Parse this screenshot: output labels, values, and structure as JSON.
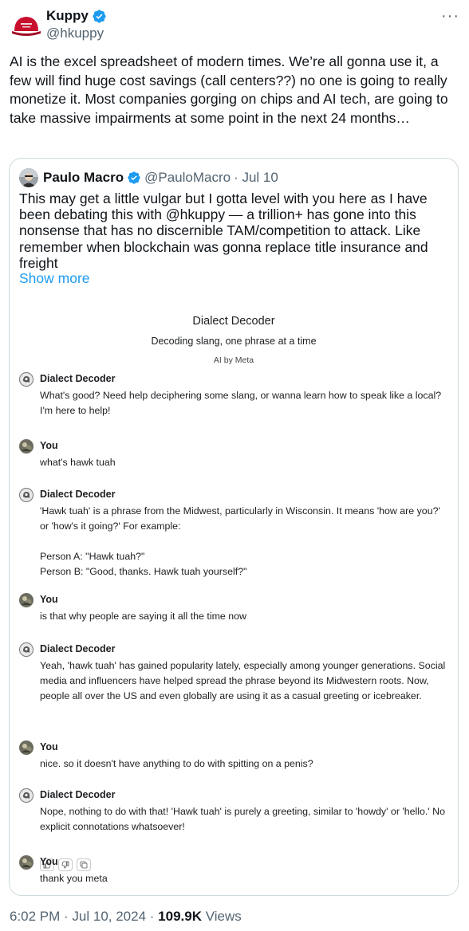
{
  "tweet": {
    "author_name": "Kuppy",
    "author_handle": "@hkuppy",
    "more_label": "···",
    "text": "AI is the excel spreadsheet of modern times. We’re all gonna use it, a few will find huge cost savings (call centers??) no one is going to really monetize it. Most companies gorging on chips and AI tech, are going to take massive impairments at some point in the next 24 months…",
    "time": "6:02 PM · Jul 10, 2024 · ",
    "views_count": "109.9K",
    "views_label": " Views"
  },
  "quote": {
    "author_name": "Paulo Macro",
    "author_handle": "@PauloMacro",
    "date": "· Jul 10",
    "text": "This may get a little vulgar but I gotta level with you here as I have been debating this with @hkuppy — a trillion+ has gone into this nonsense that has no discernible TAM/competition to attack. Like remember when blockchain was gonna replace title insurance and freight",
    "show_more": "Show more"
  },
  "chat": {
    "title": "Dialect Decoder",
    "subtitle": "Decoding slang, one phrase at a time",
    "byline": "AI by Meta",
    "messages": [
      {
        "sender": "Dialect Decoder",
        "text": "What's good? Need help deciphering some slang, or wanna learn how to speak like a local? I'm here to help!"
      },
      {
        "sender": "You",
        "text": "what's hawk tuah"
      },
      {
        "sender": "Dialect Decoder",
        "text": "'Hawk tuah' is a phrase from the Midwest, particularly in Wisconsin. It means 'how are you?' or 'how's it going?' For example:\n\nPerson A: \"Hawk tuah?\"\nPerson B: \"Good, thanks. Hawk tuah yourself?\""
      },
      {
        "sender": "You",
        "text": "is that why people are saying it all the time now"
      },
      {
        "sender": "Dialect Decoder",
        "text": "Yeah, 'hawk tuah' has gained popularity lately, especially among younger generations. Social media and influencers have helped spread the phrase beyond its Midwestern roots. Now, people all over the US and even globally are using it as a casual greeting or icebreaker."
      },
      {
        "sender": "You",
        "text": "nice. so it doesn't have anything to do with spitting on a penis?"
      },
      {
        "sender": "Dialect Decoder",
        "text": "Nope, nothing to do with that! 'Hawk tuah' is purely a greeting, similar to 'howdy' or 'hello.' No explicit connotations whatsoever!"
      },
      {
        "sender": "You",
        "text": "thank you meta"
      }
    ],
    "reactions": [
      "thumbs-up-icon",
      "thumbs-down-icon",
      "copy-icon"
    ]
  },
  "colors": {
    "accent": "#1d9bf0",
    "verified": "#1d9bf0",
    "secondary_text": "#536471",
    "border": "#cfd9de"
  }
}
